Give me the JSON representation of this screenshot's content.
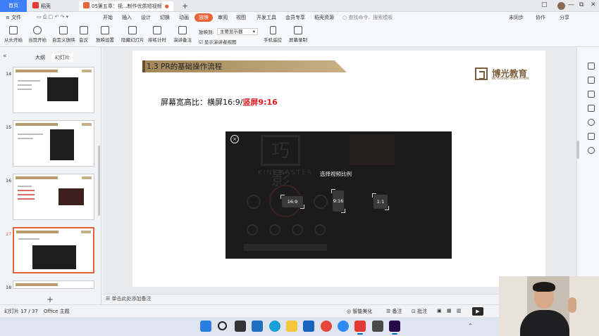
{
  "window": {
    "tabs": [
      {
        "label": "首页"
      },
      {
        "label": "稻壳"
      },
      {
        "label": "05第五章：视...制作优质短视频"
      }
    ],
    "new_tab": "+",
    "controls": [
      "□",
      "—",
      "⧉",
      "✕"
    ]
  },
  "menu": {
    "file": "≡ 文件",
    "items": [
      "开始",
      "插入",
      "设计",
      "切换",
      "动画",
      "放映",
      "审阅",
      "视图",
      "开发工具",
      "会员专享",
      "稻壳资源"
    ],
    "active": "放映",
    "search_placeholder": "查找命令、搜索模板",
    "right": [
      "未同步",
      "协作",
      "分享"
    ]
  },
  "toolbar": {
    "buttons": [
      "从头开始",
      "当页开始",
      "自定义放映",
      "会议",
      "放映设置",
      "隐藏幻灯片",
      "排练计时",
      "演讲备注",
      "手机遥控",
      "屏幕录制"
    ],
    "play_to_label": "放映到:",
    "play_to_value": "主要显示器",
    "presenter_view": "显示演讲者视图"
  },
  "left_panel": {
    "tabs": [
      "大纲",
      "幻灯片"
    ],
    "active_tab": "幻灯片",
    "slide_numbers": [
      "14",
      "15",
      "16",
      "17",
      "18"
    ],
    "active_slide": "17",
    "add_button": "+"
  },
  "slide": {
    "title": "1.3 PR的基础操作流程",
    "brand_name": "博光教育",
    "brand_en": "BO GUANG EDUCATION",
    "ratio_prefix": "屏幕宽高比：横屏16:9/",
    "ratio_highlight": "竖屏9:16",
    "video": {
      "ghost_logo": "巧影",
      "ghost_word": "KINEMASTER",
      "prompt": "选择视频比例",
      "options": [
        "16:9",
        "9:16",
        "1:1"
      ],
      "close_icon": "×"
    }
  },
  "notes": {
    "placeholder": "单击此处添加备注"
  },
  "status": {
    "slide_counter": "幻灯片 17 / 37",
    "theme": "Office 主题",
    "smart_beautify": "智能美化",
    "notes": "备注",
    "comments": "批注"
  },
  "colors": {
    "accent": "#e8633a",
    "title_bar": "#b89a6a",
    "red_text": "#e0181e",
    "brand": "#7b5e3b"
  }
}
